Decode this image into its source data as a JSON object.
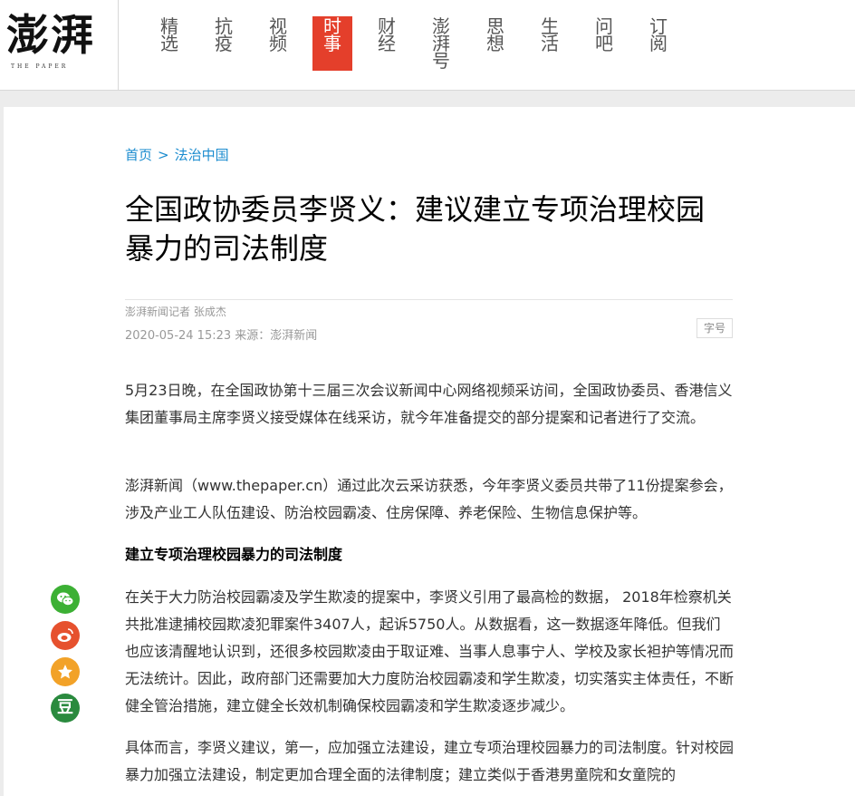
{
  "logo": {
    "text": "澎湃",
    "subtitle": "THE PAPER"
  },
  "nav": [
    {
      "label": "精选",
      "active": false
    },
    {
      "label": "抗疫",
      "active": false
    },
    {
      "label": "视频",
      "active": false
    },
    {
      "label": "时事",
      "active": true
    },
    {
      "label": "财经",
      "active": false
    },
    {
      "label": "澎湃号",
      "active": false
    },
    {
      "label": "思想",
      "active": false
    },
    {
      "label": "生活",
      "active": false
    },
    {
      "label": "问吧",
      "active": false
    },
    {
      "label": "订阅",
      "active": false
    }
  ],
  "breadcrumb": {
    "home": "首页",
    "separator": ">",
    "section": "法治中国"
  },
  "article": {
    "title": "全国政协委员李贤义：建议建立专项治理校园暴力的司法制度",
    "author": "澎湃新闻记者 张成杰",
    "date_source": "2020-05-24 15:23 来源：澎湃新闻",
    "font_size_label": "字号",
    "paragraphs": [
      "5月23日晚，在全国政协第十三届三次会议新闻中心网络视频采访间，全国政协委员、香港信义集团董事局主席李贤义接受媒体在线采访，就今年准备提交的部分提案和记者进行了交流。",
      "澎湃新闻（www.thepaper.cn）通过此次云采访获悉，今年李贤义委员共带了11份提案参会，涉及产业工人队伍建设、防治校园霸凌、住房保障、养老保险、生物信息保护等。",
      "建立专项治理校园暴力的司法制度",
      "在关于大力防治校园霸凌及学生欺凌的提案中，李贤义引用了最高检的数据， 2018年检察机关共批准逮捕校园欺凌犯罪案件3407人，起诉5750人。从数据看，这一数据逐年降低。但我们也应该清醒地认识到，还很多校园欺凌由于取证难、当事人息事宁人、学校及家长袒护等情况而无法统计。因此，政府部门还需要加大力度防治校园霸凌和学生欺凌，切实落实主体责任，不断健全管治措施，建立健全长效机制确保校园霸凌和学生欺凌逐步减少。",
      "具体而言，李贤义建议，第一，应加强立法建设，建立专项治理校园暴力的司法制度。针对校园暴力加强立法建设，制定更加合理全面的法律制度；建立类似于香港男童院和女童院的"
    ]
  },
  "share": {
    "icons": [
      "wechat-icon",
      "weibo-icon",
      "qzone-icon",
      "douban-icon"
    ],
    "douban_label": "豆",
    "colors": {
      "wechat": "#3cb034",
      "weibo": "#e6512e",
      "qzone": "#f2a228",
      "douban": "#2a8a3e"
    }
  },
  "colors": {
    "accent": "#e43f2b",
    "link": "#1b8ccf"
  }
}
